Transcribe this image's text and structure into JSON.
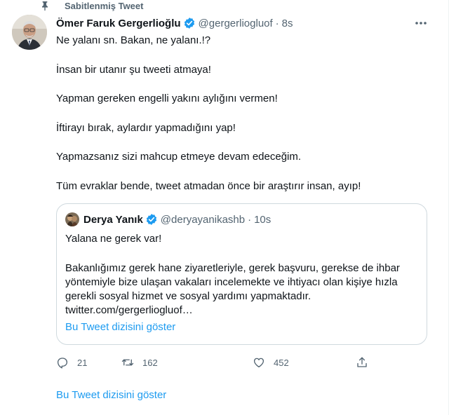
{
  "pinned": {
    "label": "Sabitlenmiş Tweet",
    "icon": "pin-icon"
  },
  "tweet": {
    "author_name": "Ömer Faruk Gergerlioğlu",
    "handle": "@gergerliogluof",
    "separator": "·",
    "time": "8s",
    "lines": [
      "Ne yalanı sn. Bakan, ne yalanı.!?",
      "İnsan bir utanır şu tweeti atmaya!",
      "Yapman gereken engelli yakını aylığını vermen!",
      "İftirayı bırak, aylardır yapmadığını yap!",
      "Yapmazsanız sizi mahcup etmeye devam edeceğim.",
      "Tüm evraklar bende, tweet atmadan önce bir araştırır insan, ayıp!"
    ]
  },
  "quote": {
    "author_name": "Derya Yanık",
    "handle": "@deryayanikashb",
    "separator": "·",
    "time": "10s",
    "lines": [
      "Yalana ne gerek var!",
      "Bakanlığımız gerek hane ziyaretleriyle, gerek başvuru, gerekse de ihbar",
      "yöntemiyle bize ulaşan vakaları incelemekte ve ihtiyacı olan kişiye hızla",
      "gerekli sosyal hizmet ve sosyal yardımı yapmaktadır.",
      "twitter.com/gergerliogluof…"
    ],
    "show_thread": "Bu Tweet dizisini göster"
  },
  "actions": {
    "replies": "21",
    "retweets": "162",
    "likes": "452"
  },
  "show_thread": "Bu Tweet dizisini göster",
  "colors": {
    "accent": "#1d9bf0",
    "secondary_text": "#536471",
    "border": "#cfd9de"
  }
}
